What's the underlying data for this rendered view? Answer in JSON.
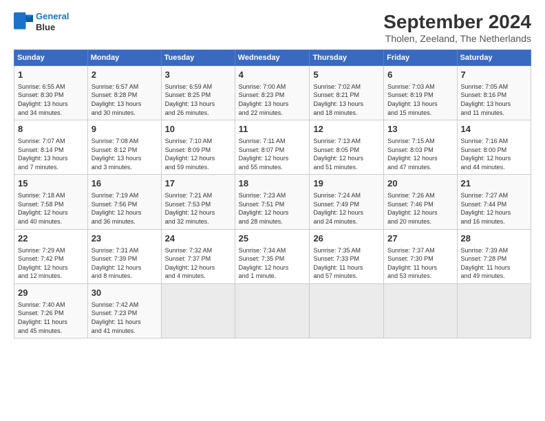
{
  "logo": {
    "line1": "General",
    "line2": "Blue"
  },
  "title": "September 2024",
  "subtitle": "Tholen, Zeeland, The Netherlands",
  "headers": [
    "Sunday",
    "Monday",
    "Tuesday",
    "Wednesday",
    "Thursday",
    "Friday",
    "Saturday"
  ],
  "weeks": [
    [
      {
        "day": "1",
        "info": "Sunrise: 6:55 AM\nSunset: 8:30 PM\nDaylight: 13 hours\nand 34 minutes."
      },
      {
        "day": "2",
        "info": "Sunrise: 6:57 AM\nSunset: 8:28 PM\nDaylight: 13 hours\nand 30 minutes."
      },
      {
        "day": "3",
        "info": "Sunrise: 6:59 AM\nSunset: 8:25 PM\nDaylight: 13 hours\nand 26 minutes."
      },
      {
        "day": "4",
        "info": "Sunrise: 7:00 AM\nSunset: 8:23 PM\nDaylight: 13 hours\nand 22 minutes."
      },
      {
        "day": "5",
        "info": "Sunrise: 7:02 AM\nSunset: 8:21 PM\nDaylight: 13 hours\nand 18 minutes."
      },
      {
        "day": "6",
        "info": "Sunrise: 7:03 AM\nSunset: 8:19 PM\nDaylight: 13 hours\nand 15 minutes."
      },
      {
        "day": "7",
        "info": "Sunrise: 7:05 AM\nSunset: 8:16 PM\nDaylight: 13 hours\nand 11 minutes."
      }
    ],
    [
      {
        "day": "8",
        "info": "Sunrise: 7:07 AM\nSunset: 8:14 PM\nDaylight: 13 hours\nand 7 minutes."
      },
      {
        "day": "9",
        "info": "Sunrise: 7:08 AM\nSunset: 8:12 PM\nDaylight: 13 hours\nand 3 minutes."
      },
      {
        "day": "10",
        "info": "Sunrise: 7:10 AM\nSunset: 8:09 PM\nDaylight: 12 hours\nand 59 minutes."
      },
      {
        "day": "11",
        "info": "Sunrise: 7:11 AM\nSunset: 8:07 PM\nDaylight: 12 hours\nand 55 minutes."
      },
      {
        "day": "12",
        "info": "Sunrise: 7:13 AM\nSunset: 8:05 PM\nDaylight: 12 hours\nand 51 minutes."
      },
      {
        "day": "13",
        "info": "Sunrise: 7:15 AM\nSunset: 8:03 PM\nDaylight: 12 hours\nand 47 minutes."
      },
      {
        "day": "14",
        "info": "Sunrise: 7:16 AM\nSunset: 8:00 PM\nDaylight: 12 hours\nand 44 minutes."
      }
    ],
    [
      {
        "day": "15",
        "info": "Sunrise: 7:18 AM\nSunset: 7:58 PM\nDaylight: 12 hours\nand 40 minutes."
      },
      {
        "day": "16",
        "info": "Sunrise: 7:19 AM\nSunset: 7:56 PM\nDaylight: 12 hours\nand 36 minutes."
      },
      {
        "day": "17",
        "info": "Sunrise: 7:21 AM\nSunset: 7:53 PM\nDaylight: 12 hours\nand 32 minutes."
      },
      {
        "day": "18",
        "info": "Sunrise: 7:23 AM\nSunset: 7:51 PM\nDaylight: 12 hours\nand 28 minutes."
      },
      {
        "day": "19",
        "info": "Sunrise: 7:24 AM\nSunset: 7:49 PM\nDaylight: 12 hours\nand 24 minutes."
      },
      {
        "day": "20",
        "info": "Sunrise: 7:26 AM\nSunset: 7:46 PM\nDaylight: 12 hours\nand 20 minutes."
      },
      {
        "day": "21",
        "info": "Sunrise: 7:27 AM\nSunset: 7:44 PM\nDaylight: 12 hours\nand 16 minutes."
      }
    ],
    [
      {
        "day": "22",
        "info": "Sunrise: 7:29 AM\nSunset: 7:42 PM\nDaylight: 12 hours\nand 12 minutes."
      },
      {
        "day": "23",
        "info": "Sunrise: 7:31 AM\nSunset: 7:39 PM\nDaylight: 12 hours\nand 8 minutes."
      },
      {
        "day": "24",
        "info": "Sunrise: 7:32 AM\nSunset: 7:37 PM\nDaylight: 12 hours\nand 4 minutes."
      },
      {
        "day": "25",
        "info": "Sunrise: 7:34 AM\nSunset: 7:35 PM\nDaylight: 12 hours\nand 1 minute."
      },
      {
        "day": "26",
        "info": "Sunrise: 7:35 AM\nSunset: 7:33 PM\nDaylight: 11 hours\nand 57 minutes."
      },
      {
        "day": "27",
        "info": "Sunrise: 7:37 AM\nSunset: 7:30 PM\nDaylight: 11 hours\nand 53 minutes."
      },
      {
        "day": "28",
        "info": "Sunrise: 7:39 AM\nSunset: 7:28 PM\nDaylight: 11 hours\nand 49 minutes."
      }
    ],
    [
      {
        "day": "29",
        "info": "Sunrise: 7:40 AM\nSunset: 7:26 PM\nDaylight: 11 hours\nand 45 minutes."
      },
      {
        "day": "30",
        "info": "Sunrise: 7:42 AM\nSunset: 7:23 PM\nDaylight: 11 hours\nand 41 minutes."
      },
      null,
      null,
      null,
      null,
      null
    ]
  ]
}
